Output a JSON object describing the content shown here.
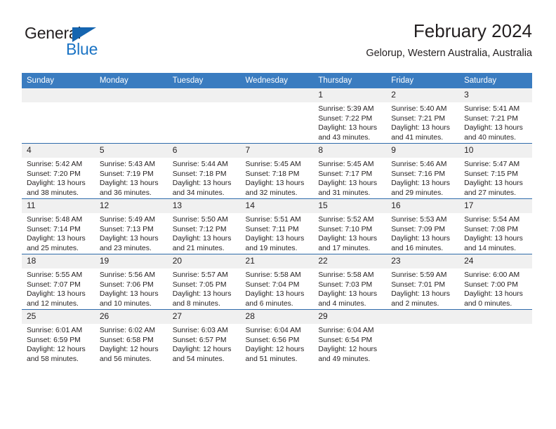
{
  "brand": {
    "name_part1": "General",
    "name_part2": "Blue",
    "triangle_color": "#1565b0",
    "blue_color": "#1a73c4"
  },
  "header": {
    "title": "February 2024",
    "subtitle": "Gelorup, Western Australia, Australia"
  },
  "theme": {
    "header_bg": "#3a7cc0",
    "row_divider": "#2f6bab",
    "daynum_bg": "#f0f0f0",
    "text": "#231f20"
  },
  "weekdays": [
    "Sunday",
    "Monday",
    "Tuesday",
    "Wednesday",
    "Thursday",
    "Friday",
    "Saturday"
  ],
  "weeks": [
    [
      {
        "day": ""
      },
      {
        "day": ""
      },
      {
        "day": ""
      },
      {
        "day": ""
      },
      {
        "day": "1",
        "sunrise": "Sunrise: 5:39 AM",
        "sunset": "Sunset: 7:22 PM",
        "daylight": "Daylight: 13 hours and 43 minutes."
      },
      {
        "day": "2",
        "sunrise": "Sunrise: 5:40 AM",
        "sunset": "Sunset: 7:21 PM",
        "daylight": "Daylight: 13 hours and 41 minutes."
      },
      {
        "day": "3",
        "sunrise": "Sunrise: 5:41 AM",
        "sunset": "Sunset: 7:21 PM",
        "daylight": "Daylight: 13 hours and 40 minutes."
      }
    ],
    [
      {
        "day": "4",
        "sunrise": "Sunrise: 5:42 AM",
        "sunset": "Sunset: 7:20 PM",
        "daylight": "Daylight: 13 hours and 38 minutes."
      },
      {
        "day": "5",
        "sunrise": "Sunrise: 5:43 AM",
        "sunset": "Sunset: 7:19 PM",
        "daylight": "Daylight: 13 hours and 36 minutes."
      },
      {
        "day": "6",
        "sunrise": "Sunrise: 5:44 AM",
        "sunset": "Sunset: 7:18 PM",
        "daylight": "Daylight: 13 hours and 34 minutes."
      },
      {
        "day": "7",
        "sunrise": "Sunrise: 5:45 AM",
        "sunset": "Sunset: 7:18 PM",
        "daylight": "Daylight: 13 hours and 32 minutes."
      },
      {
        "day": "8",
        "sunrise": "Sunrise: 5:45 AM",
        "sunset": "Sunset: 7:17 PM",
        "daylight": "Daylight: 13 hours and 31 minutes."
      },
      {
        "day": "9",
        "sunrise": "Sunrise: 5:46 AM",
        "sunset": "Sunset: 7:16 PM",
        "daylight": "Daylight: 13 hours and 29 minutes."
      },
      {
        "day": "10",
        "sunrise": "Sunrise: 5:47 AM",
        "sunset": "Sunset: 7:15 PM",
        "daylight": "Daylight: 13 hours and 27 minutes."
      }
    ],
    [
      {
        "day": "11",
        "sunrise": "Sunrise: 5:48 AM",
        "sunset": "Sunset: 7:14 PM",
        "daylight": "Daylight: 13 hours and 25 minutes."
      },
      {
        "day": "12",
        "sunrise": "Sunrise: 5:49 AM",
        "sunset": "Sunset: 7:13 PM",
        "daylight": "Daylight: 13 hours and 23 minutes."
      },
      {
        "day": "13",
        "sunrise": "Sunrise: 5:50 AM",
        "sunset": "Sunset: 7:12 PM",
        "daylight": "Daylight: 13 hours and 21 minutes."
      },
      {
        "day": "14",
        "sunrise": "Sunrise: 5:51 AM",
        "sunset": "Sunset: 7:11 PM",
        "daylight": "Daylight: 13 hours and 19 minutes."
      },
      {
        "day": "15",
        "sunrise": "Sunrise: 5:52 AM",
        "sunset": "Sunset: 7:10 PM",
        "daylight": "Daylight: 13 hours and 17 minutes."
      },
      {
        "day": "16",
        "sunrise": "Sunrise: 5:53 AM",
        "sunset": "Sunset: 7:09 PM",
        "daylight": "Daylight: 13 hours and 16 minutes."
      },
      {
        "day": "17",
        "sunrise": "Sunrise: 5:54 AM",
        "sunset": "Sunset: 7:08 PM",
        "daylight": "Daylight: 13 hours and 14 minutes."
      }
    ],
    [
      {
        "day": "18",
        "sunrise": "Sunrise: 5:55 AM",
        "sunset": "Sunset: 7:07 PM",
        "daylight": "Daylight: 13 hours and 12 minutes."
      },
      {
        "day": "19",
        "sunrise": "Sunrise: 5:56 AM",
        "sunset": "Sunset: 7:06 PM",
        "daylight": "Daylight: 13 hours and 10 minutes."
      },
      {
        "day": "20",
        "sunrise": "Sunrise: 5:57 AM",
        "sunset": "Sunset: 7:05 PM",
        "daylight": "Daylight: 13 hours and 8 minutes."
      },
      {
        "day": "21",
        "sunrise": "Sunrise: 5:58 AM",
        "sunset": "Sunset: 7:04 PM",
        "daylight": "Daylight: 13 hours and 6 minutes."
      },
      {
        "day": "22",
        "sunrise": "Sunrise: 5:58 AM",
        "sunset": "Sunset: 7:03 PM",
        "daylight": "Daylight: 13 hours and 4 minutes."
      },
      {
        "day": "23",
        "sunrise": "Sunrise: 5:59 AM",
        "sunset": "Sunset: 7:01 PM",
        "daylight": "Daylight: 13 hours and 2 minutes."
      },
      {
        "day": "24",
        "sunrise": "Sunrise: 6:00 AM",
        "sunset": "Sunset: 7:00 PM",
        "daylight": "Daylight: 13 hours and 0 minutes."
      }
    ],
    [
      {
        "day": "25",
        "sunrise": "Sunrise: 6:01 AM",
        "sunset": "Sunset: 6:59 PM",
        "daylight": "Daylight: 12 hours and 58 minutes."
      },
      {
        "day": "26",
        "sunrise": "Sunrise: 6:02 AM",
        "sunset": "Sunset: 6:58 PM",
        "daylight": "Daylight: 12 hours and 56 minutes."
      },
      {
        "day": "27",
        "sunrise": "Sunrise: 6:03 AM",
        "sunset": "Sunset: 6:57 PM",
        "daylight": "Daylight: 12 hours and 54 minutes."
      },
      {
        "day": "28",
        "sunrise": "Sunrise: 6:04 AM",
        "sunset": "Sunset: 6:56 PM",
        "daylight": "Daylight: 12 hours and 51 minutes."
      },
      {
        "day": "29",
        "sunrise": "Sunrise: 6:04 AM",
        "sunset": "Sunset: 6:54 PM",
        "daylight": "Daylight: 12 hours and 49 minutes."
      },
      {
        "day": ""
      },
      {
        "day": ""
      }
    ]
  ]
}
